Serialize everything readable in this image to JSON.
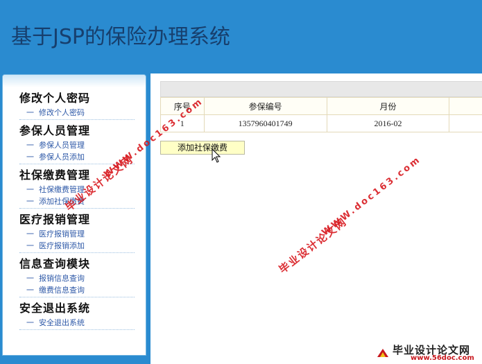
{
  "header": {
    "title": "基于JSP的保险办理系统"
  },
  "sidebar": {
    "bullet": "一",
    "groups": [
      {
        "title": "修改个人密码",
        "items": [
          "修改个人密码"
        ]
      },
      {
        "title": "参保人员管理",
        "items": [
          "参保人员管理",
          "参保人员添加"
        ]
      },
      {
        "title": "社保缴费管理",
        "items": [
          "社保缴费管理",
          "添加社保缴费"
        ]
      },
      {
        "title": "医疗报销管理",
        "items": [
          "医疗报销管理",
          "医疗报销添加"
        ]
      },
      {
        "title": "信息查询模块",
        "items": [
          "报销信息查询",
          "缴费信息查询"
        ]
      },
      {
        "title": "安全退出系统",
        "items": [
          "安全退出系统"
        ]
      }
    ]
  },
  "table": {
    "columns": [
      "序号",
      "参保编号",
      "月份"
    ],
    "rows": [
      [
        "1",
        "1357960401749",
        "2016-02"
      ]
    ]
  },
  "add_button": "添加社保缴费",
  "watermarks": {
    "cn": "毕业设计论文网",
    "url": "WWW.doc163.com"
  },
  "logo": {
    "cn": "毕业设计论文网",
    "url": "www.56doc.com"
  }
}
